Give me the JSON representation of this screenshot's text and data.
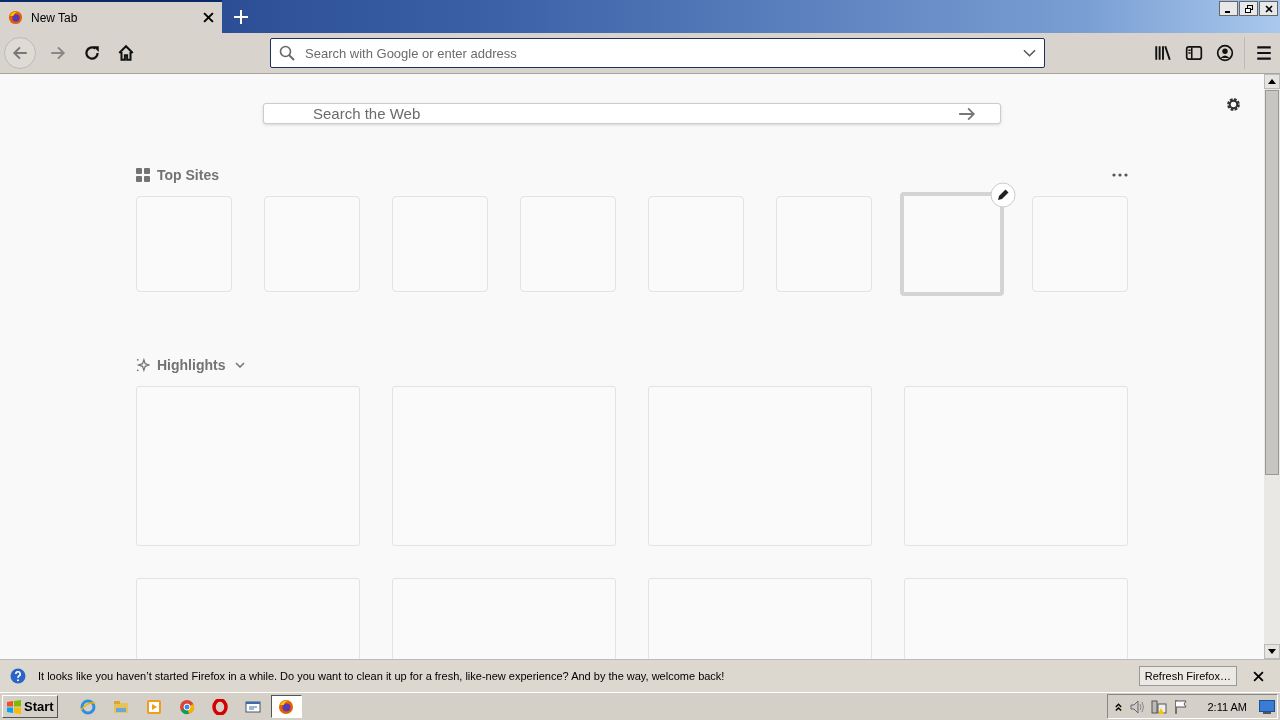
{
  "tab": {
    "title": "New Tab",
    "selected": true
  },
  "address_bar": {
    "placeholder": "Search with Google or enter address"
  },
  "search": {
    "placeholder": "Search the Web"
  },
  "top_sites": {
    "title": "Top Sites",
    "tiles": [
      {
        "hovered": false
      },
      {
        "hovered": false
      },
      {
        "hovered": false
      },
      {
        "hovered": false
      },
      {
        "hovered": false
      },
      {
        "hovered": false
      },
      {
        "hovered": true
      },
      {
        "hovered": false
      }
    ]
  },
  "highlights": {
    "title": "Highlights",
    "expanded": true,
    "cards": [
      {
        "kind": "placeholder"
      },
      {
        "kind": "placeholder"
      },
      {
        "kind": "placeholder"
      },
      {
        "kind": "placeholder"
      },
      {
        "kind": "placeholder"
      },
      {
        "kind": "placeholder"
      },
      {
        "kind": "placeholder"
      },
      {
        "kind": "placeholder"
      }
    ]
  },
  "notification": {
    "text": "It looks like you haven’t started Firefox in a while. Do you want to clean it up for a fresh, like-new experience? And by the way, welcome back!",
    "button": "Refresh Firefox…"
  },
  "taskbar": {
    "start": "Start",
    "apps": [
      {
        "kind": "ie",
        "selected": false
      },
      {
        "kind": "explorer",
        "selected": false
      },
      {
        "kind": "media",
        "selected": false
      },
      {
        "kind": "chrome",
        "selected": false
      },
      {
        "kind": "opera",
        "selected": false
      },
      {
        "kind": "remote",
        "selected": false
      },
      {
        "kind": "firefox",
        "selected": true
      }
    ],
    "clock": "2:11 AM"
  }
}
